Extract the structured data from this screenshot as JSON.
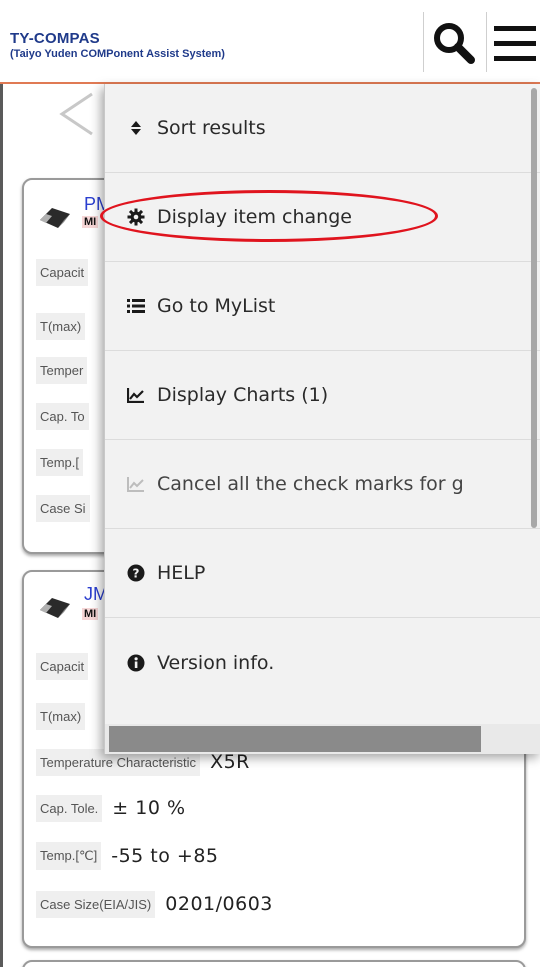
{
  "header": {
    "title": "TY-COMPAS",
    "subtitle": "(Taiyo Yuden COMPonent Assist System)",
    "search_icon": "search-icon",
    "menu_icon": "hamburger-menu-icon"
  },
  "nav": {
    "back_icon": "chevron-left-icon"
  },
  "cards": [
    {
      "name": "PM",
      "badge": "MI",
      "rows": [
        {
          "label": "Capacit",
          "value": ""
        },
        {
          "label": "T(max)",
          "value": ""
        },
        {
          "label": "Temper",
          "value": ""
        },
        {
          "label": "Cap. To",
          "value": ""
        },
        {
          "label": "Temp.[",
          "value": ""
        },
        {
          "label": "Case Si",
          "value": ""
        }
      ]
    },
    {
      "name": "JM",
      "badge": "MI",
      "rows": [
        {
          "label": "Capacit",
          "value": ""
        },
        {
          "label": "T(max)",
          "value": ""
        },
        {
          "label": "Temperature Characteristic",
          "value": "X5R"
        },
        {
          "label": "Cap. Tole.",
          "value": "± 10 %"
        },
        {
          "label": "Temp.[℃]",
          "value": "-55 to +85"
        },
        {
          "label": "Case Size(EIA/JIS)",
          "value": "0201/0603"
        }
      ]
    }
  ],
  "menu": {
    "items": [
      {
        "icon": "sort-icon",
        "label": "Sort results"
      },
      {
        "icon": "gear-icon",
        "label": "Display item change"
      },
      {
        "icon": "list-icon",
        "label": "Go to MyList"
      },
      {
        "icon": "line-chart-icon",
        "label": "Display Charts (1)"
      },
      {
        "icon": "line-chart-icon",
        "label": "Cancel all the check marks for g"
      },
      {
        "icon": "question-circle-icon",
        "label": "HELP"
      },
      {
        "icon": "info-circle-icon",
        "label": "Version info."
      }
    ]
  },
  "colors": {
    "brand": "#1f3a8a",
    "header_border": "#e07a54",
    "link": "#2b3fcf",
    "highlight": "#e0141e"
  }
}
